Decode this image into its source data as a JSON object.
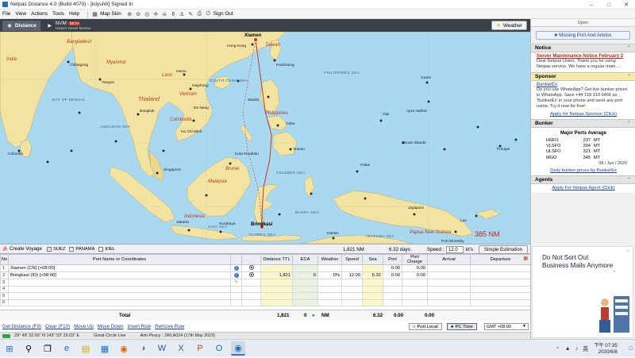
{
  "window": {
    "title": "Netpas Distance 4.0 (Build 4070) - [kiiyuiW] Signed In",
    "controls": [
      "–",
      "□",
      "✕"
    ]
  },
  "menu": {
    "items": [
      "File",
      "View",
      "Actions",
      "Tools",
      "Help"
    ],
    "map_skin": "Map Skin",
    "sign_out": "Sign Out"
  },
  "tabs": {
    "distance": "Distance",
    "nvm": "NVM",
    "nvm_badge": "BETA",
    "nvm_sub": "Netpas Vessel Monitor",
    "weather": "Weather"
  },
  "map": {
    "labels": {
      "india": "India",
      "bangladesh": "Bangladesh",
      "myanmar": "Myanmar",
      "laos": "Laos",
      "thailand": "Thailand",
      "vietnam": "Vietnam",
      "cambodia": "Cambodia",
      "malaysia": "Malaysia",
      "brunei": "Brunei",
      "indonesia": "Indonesia",
      "philippines": "Philippines",
      "taiwan": "Taiwan",
      "papua": "Papua New Guinea",
      "bay_bengal": "BAY OF BENGAL",
      "andaman": "ANDAMAN SEA",
      "south_china_sea": "SOUTH CHINA SEA",
      "philippine_sea": "PHILIPPINES SEA",
      "celebes_sea": "CELEBES SEA",
      "java_sea": "JAVA SEA",
      "flores_sea": "FLORES SEA",
      "banda_sea": "BANDA SEA",
      "arafura_sea": "ARAFURA SEA",
      "xiamen": "Xiamen",
      "bringkasi": "Bringkasi",
      "colombo": "Colombo",
      "chittagong": "Chittagong",
      "yangon": "Yangon",
      "bangkok": "Bangkok",
      "hanoi": "Hanoi",
      "haiphong": "Haiphong",
      "danang": "Da Nang",
      "ho_chi_minh": "Ho Chi Minh",
      "manila": "Manila",
      "cebu": "Cebu",
      "davao": "Davao",
      "kota_kinabalu": "Kota Kinabalu",
      "singapore": "Singapore",
      "jakarta": "Jakarta",
      "surabaya": "Surabaya",
      "guam": "Guam",
      "apra": "Apra Harbor",
      "yap": "Yap",
      "palau": "Palau",
      "chuuk": "Chuuk Islands",
      "ponape": "Ponape",
      "darwin": "Darwin",
      "jayapura": "Jayapura",
      "lae": "Lae",
      "port_moresby": "Port Moresby",
      "kaohsiung": "Kaohsiung",
      "hong_kong": "Hong Kong"
    },
    "distance_value": "385",
    "distance_unit": "NM"
  },
  "route_bar": {
    "create_voyage": "Create Voyage",
    "suez": "SUEZ",
    "panama": "PANAMA",
    "kiel": "KIEL",
    "distance": "1,821",
    "distance_unit": "NM",
    "days": "6.32 days",
    "speed_label": "Speed :",
    "speed_value": "12.0",
    "speed_unit": "kt's",
    "simple_estimation": "Simple Estimation"
  },
  "grid": {
    "headers": [
      "No",
      "Port Name or Coordinates",
      "",
      "",
      "Distance TTL",
      "ECA",
      "Weather",
      "Speed",
      "Sea",
      "Port",
      "Port Charge",
      "Arrival",
      "Departure"
    ],
    "rows": [
      {
        "no": "1",
        "port": "Xiamen (CN) [+08:00]",
        "dist": "",
        "eca": "",
        "weather": "",
        "speed": "",
        "sea": "",
        "portdays": "0.00",
        "charge": "0.00",
        "arrival": "",
        "departure": ""
      },
      {
        "no": "2",
        "port": "Bringkasi (ID) [+08:00]",
        "dist": "1,821",
        "eca": "0",
        "weather": "0%",
        "speed": "12.00",
        "sea": "6.32",
        "portdays": "0.00",
        "charge": "0.00",
        "arrival": "",
        "departure": ""
      },
      {
        "no": "3",
        "port": ""
      },
      {
        "no": "4",
        "port": ""
      },
      {
        "no": "5",
        "port": ""
      },
      {
        "no": "6",
        "port": ""
      }
    ],
    "total": {
      "label": "Total",
      "dist": "1,821",
      "eca": "0",
      "unit": "NM",
      "sea": "6.32",
      "port": "0.00",
      "charge": "0.00"
    }
  },
  "actions": {
    "get_distance": "Get Distance (F9)",
    "clear": "Clear (F10)",
    "move_up": "Move Up",
    "move_down": "Move Down",
    "insert_row": "Insert Row",
    "remove_row": "Remove Row",
    "port_local": "Port Local",
    "pc_time": "PC Time",
    "timezone": "GMT +08:00"
  },
  "status": {
    "coords": "29° 48' 32.00\" N 143° 53' 29.03\" E",
    "great_circle": "Great Circle Line",
    "anti_piracy": "Anti Piracy : JWLA024 (17th May 2019)"
  },
  "right_panel": {
    "open": "Open",
    "missing_port": "Missing Port And Advice",
    "notice_head": "Notice",
    "notice_title": "Server Maintenance Notice  February 2",
    "notice_text": "Dear Netpas Users,   Thank you for using Netpas service. We have a regular main....",
    "sponsor_head": "Sponsor",
    "sponsor_title": "BunkerEx",
    "sponsor_text": "Do you use WhatsApp? Get live bunker prices in WhatsApp. Save +44 118 310 0466 as 'BunkerEx' in your phone and send any port name. Try it now for free!",
    "sponsor_link": "Apply for Netpas Sponsor (Click)",
    "bunker_head": "Bunker",
    "bunker_title": "Major Ports Average",
    "bunker_rows": [
      {
        "name": "HSFO",
        "value": "237",
        "unit": "MT"
      },
      {
        "name": "VLSFO",
        "value": "294",
        "unit": "MT"
      },
      {
        "name": "ULSFO",
        "value": "321",
        "unit": "MT"
      },
      {
        "name": "MGO",
        "value": "345",
        "unit": "MT"
      }
    ],
    "bunker_date": "08 / Jun / 2020",
    "bunker_link": "Daily bunker prices by BunkerEx",
    "agents_head": "Agents",
    "agents_link": "Apply For Netpas Agent (Click)"
  },
  "ad": {
    "line1": "Do Not Sort Out",
    "line2": "Business Mails Anymore"
  },
  "taskbar": {
    "clock_time": "下午 07:35",
    "clock_date": "2020/6/8",
    "lang": "英"
  },
  "colors": {
    "sea": "#a9d9f1",
    "land": "#f3e3a0",
    "land_alt": "#e9d78a",
    "route": "#c0392b",
    "accent": "#1a3ea8"
  }
}
